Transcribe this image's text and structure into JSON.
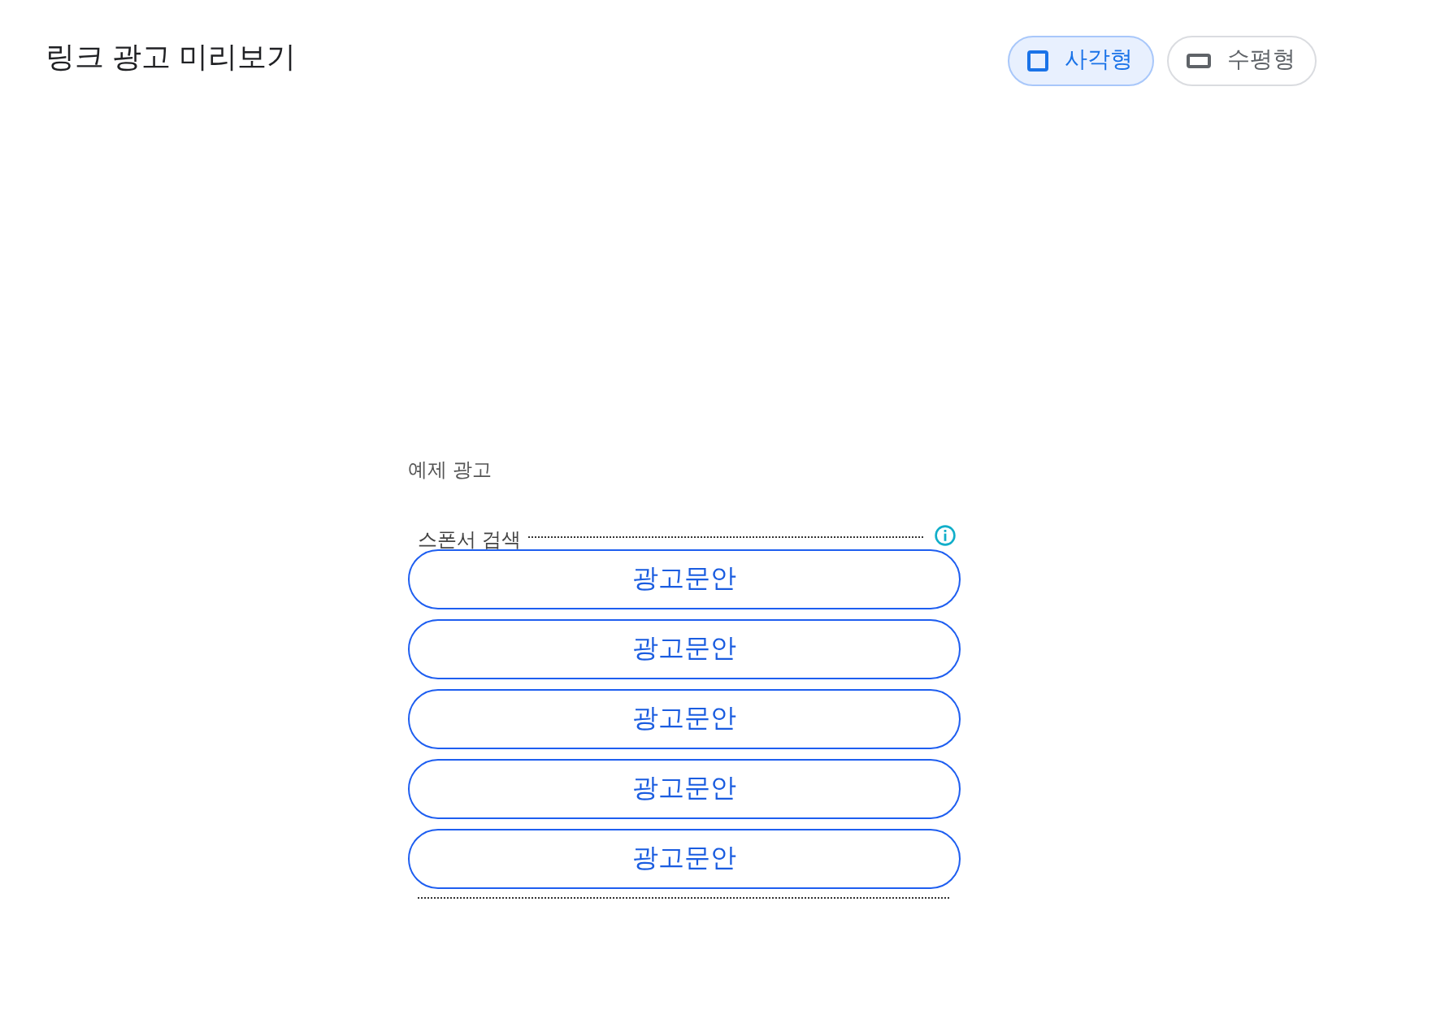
{
  "header": {
    "title": "링크 광고 미리보기",
    "layout_toggle": [
      {
        "label": "사각형",
        "kind": "square",
        "selected": true
      },
      {
        "label": "수평형",
        "kind": "horizontal",
        "selected": false
      }
    ]
  },
  "preview": {
    "caption": "예제 광고",
    "ad_unit": {
      "label": "스폰서 검색",
      "links": [
        "광고문안",
        "광고문안",
        "광고문안",
        "광고문안",
        "광고문안"
      ]
    }
  }
}
